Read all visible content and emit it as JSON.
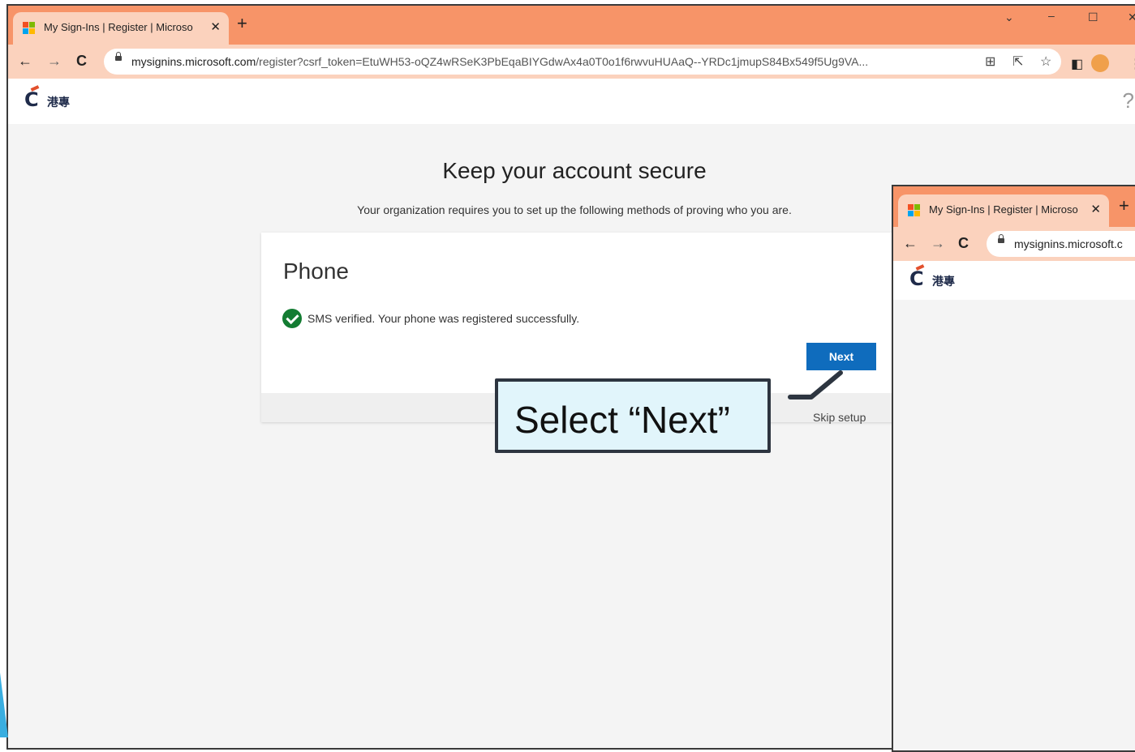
{
  "browser": {
    "tab_title": "My Sign-Ins | Register | Microso",
    "new_tab_symbol": "+",
    "url_domain": "mysignins.microsoft.com",
    "url_path": "/register?csrf_token=EtuWH53-oQZ4wRSeK3PbEqaBIYGdwAx4a0T0o1f6rwvuHUAaQ--YRDc1jmupS84Bx549f5Ug9VA...",
    "second_url_domain": "mysignins.microsoft.c"
  },
  "brand": {
    "logo_mark": "C",
    "logo_text": "港專"
  },
  "page": {
    "heading": "Keep your account secure",
    "subtitle": "Your organization requires you to set up the following methods of proving who you are.",
    "card": {
      "title": "Phone",
      "status_message": "SMS verified. Your phone was registered successfully.",
      "next_label": "Next",
      "skip_label": "Skip setup"
    }
  },
  "callout": {
    "text": "Select “Next”"
  },
  "icons": [
    "microsoft-logo-icon",
    "close-icon",
    "back-icon",
    "forward-icon",
    "reload-icon",
    "lock-icon",
    "translate-icon",
    "share-icon",
    "star-icon",
    "sidepanel-icon",
    "profile-icon",
    "menu-icon",
    "help-icon",
    "check-icon"
  ],
  "colors": {
    "chrome_accent": "#f79468",
    "primary_button": "#0f6cbd",
    "success": "#137c32",
    "callout_bg": "#e1f5fb"
  }
}
